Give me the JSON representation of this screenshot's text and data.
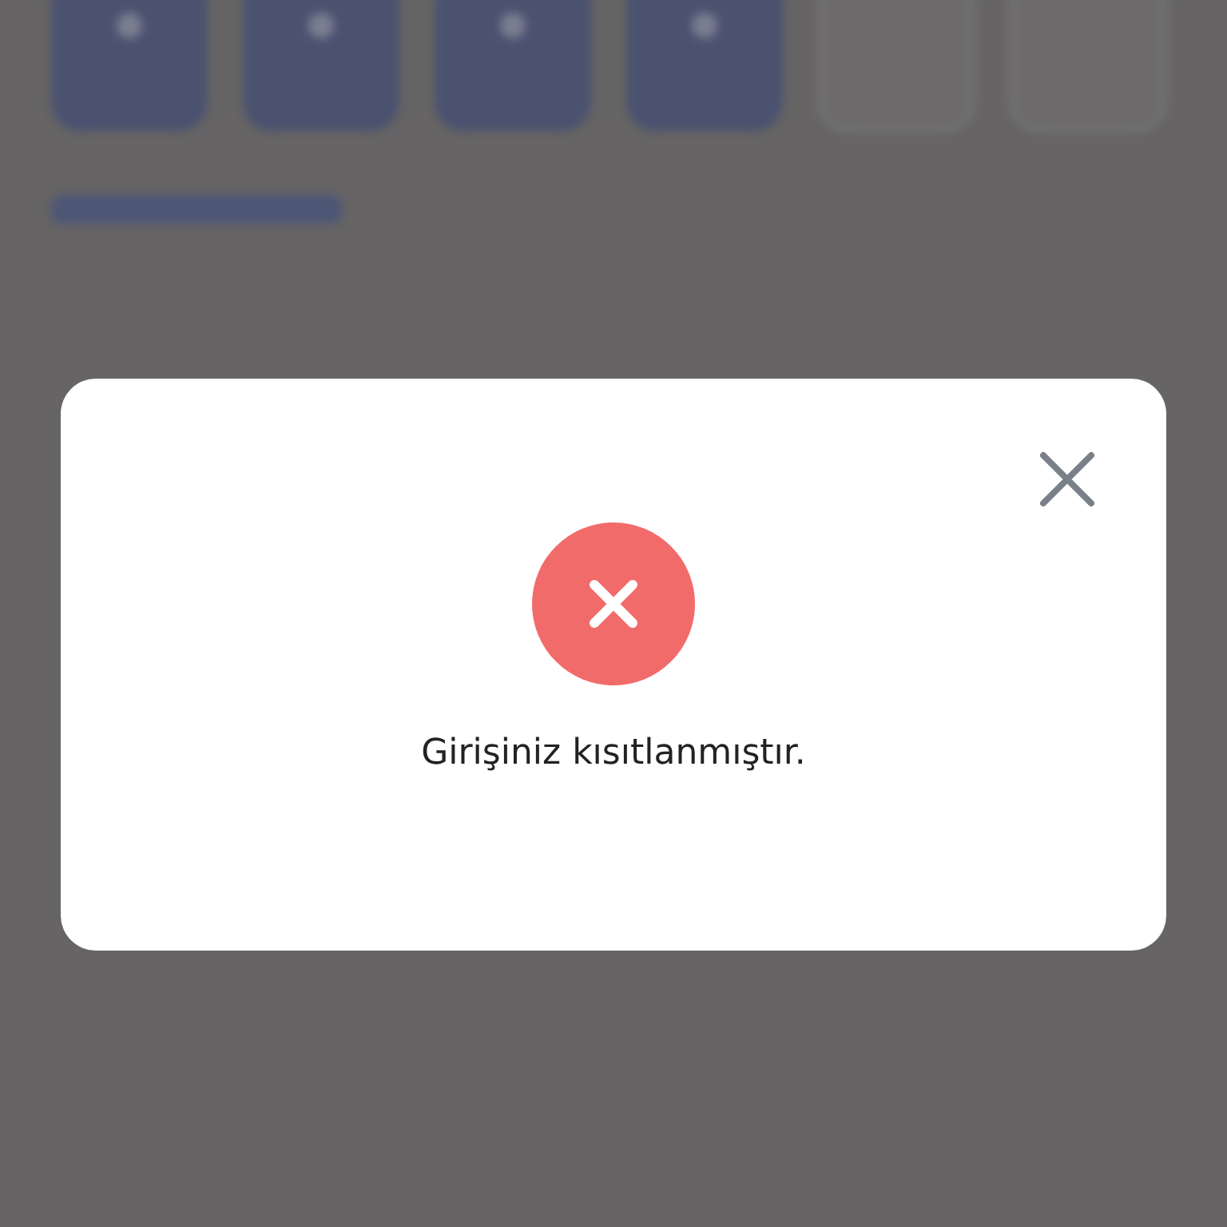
{
  "pin_boxes": [
    {
      "filled": true
    },
    {
      "filled": true
    },
    {
      "filled": true
    },
    {
      "filled": true
    },
    {
      "filled": false
    },
    {
      "filled": false
    }
  ],
  "dialog": {
    "kind": "error",
    "message": "Girişiniz kısıtlanmıştır."
  }
}
